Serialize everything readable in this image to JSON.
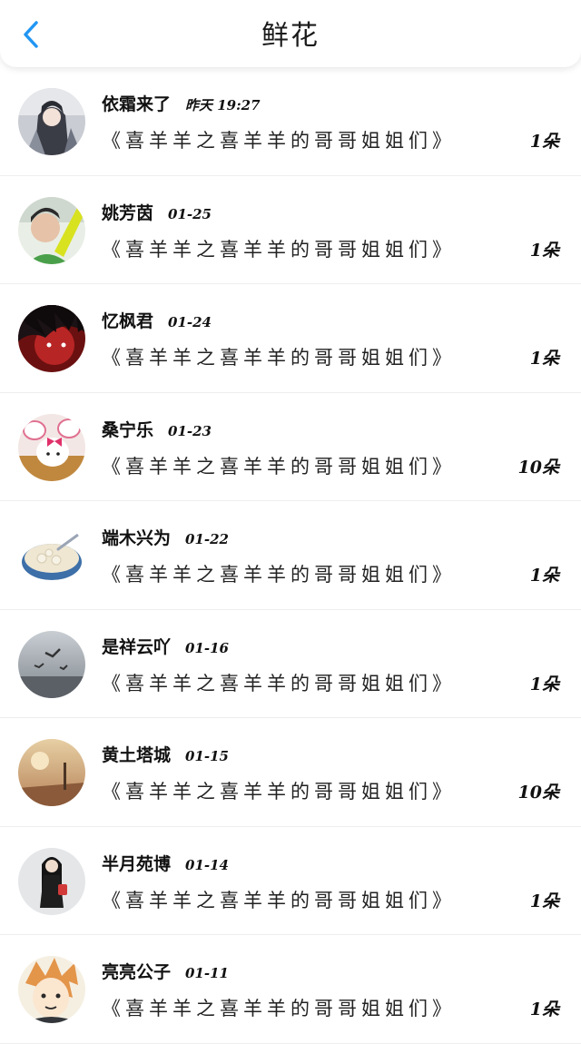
{
  "header": {
    "title": "鲜花",
    "back_icon": "chevron-left-icon",
    "accent_color": "#2196f3"
  },
  "items": [
    {
      "name": "依霜来了",
      "date": "昨天 19:27",
      "book": "《喜羊羊之喜羊羊的哥哥姐姐们》",
      "count": "1朵"
    },
    {
      "name": "姚芳茵",
      "date": "01-25",
      "book": "《喜羊羊之喜羊羊的哥哥姐姐们》",
      "count": "1朵"
    },
    {
      "name": "忆枫君",
      "date": "01-24",
      "book": "《喜羊羊之喜羊羊的哥哥姐姐们》",
      "count": "1朵"
    },
    {
      "name": "桑宁乐",
      "date": "01-23",
      "book": "《喜羊羊之喜羊羊的哥哥姐姐们》",
      "count": "10朵"
    },
    {
      "name": "端木兴为",
      "date": "01-22",
      "book": "《喜羊羊之喜羊羊的哥哥姐姐们》",
      "count": "1朵"
    },
    {
      "name": "是祥云吖",
      "date": "01-16",
      "book": "《喜羊羊之喜羊羊的哥哥姐姐们》",
      "count": "1朵"
    },
    {
      "name": "黄土塔城",
      "date": "01-15",
      "book": "《喜羊羊之喜羊羊的哥哥姐姐们》",
      "count": "10朵"
    },
    {
      "name": "半月苑博",
      "date": "01-14",
      "book": "《喜羊羊之喜羊羊的哥哥姐姐们》",
      "count": "1朵"
    },
    {
      "name": "亮亮公子",
      "date": "01-11",
      "book": "《喜羊羊之喜羊羊的哥哥姐姐们》",
      "count": "1朵"
    }
  ]
}
